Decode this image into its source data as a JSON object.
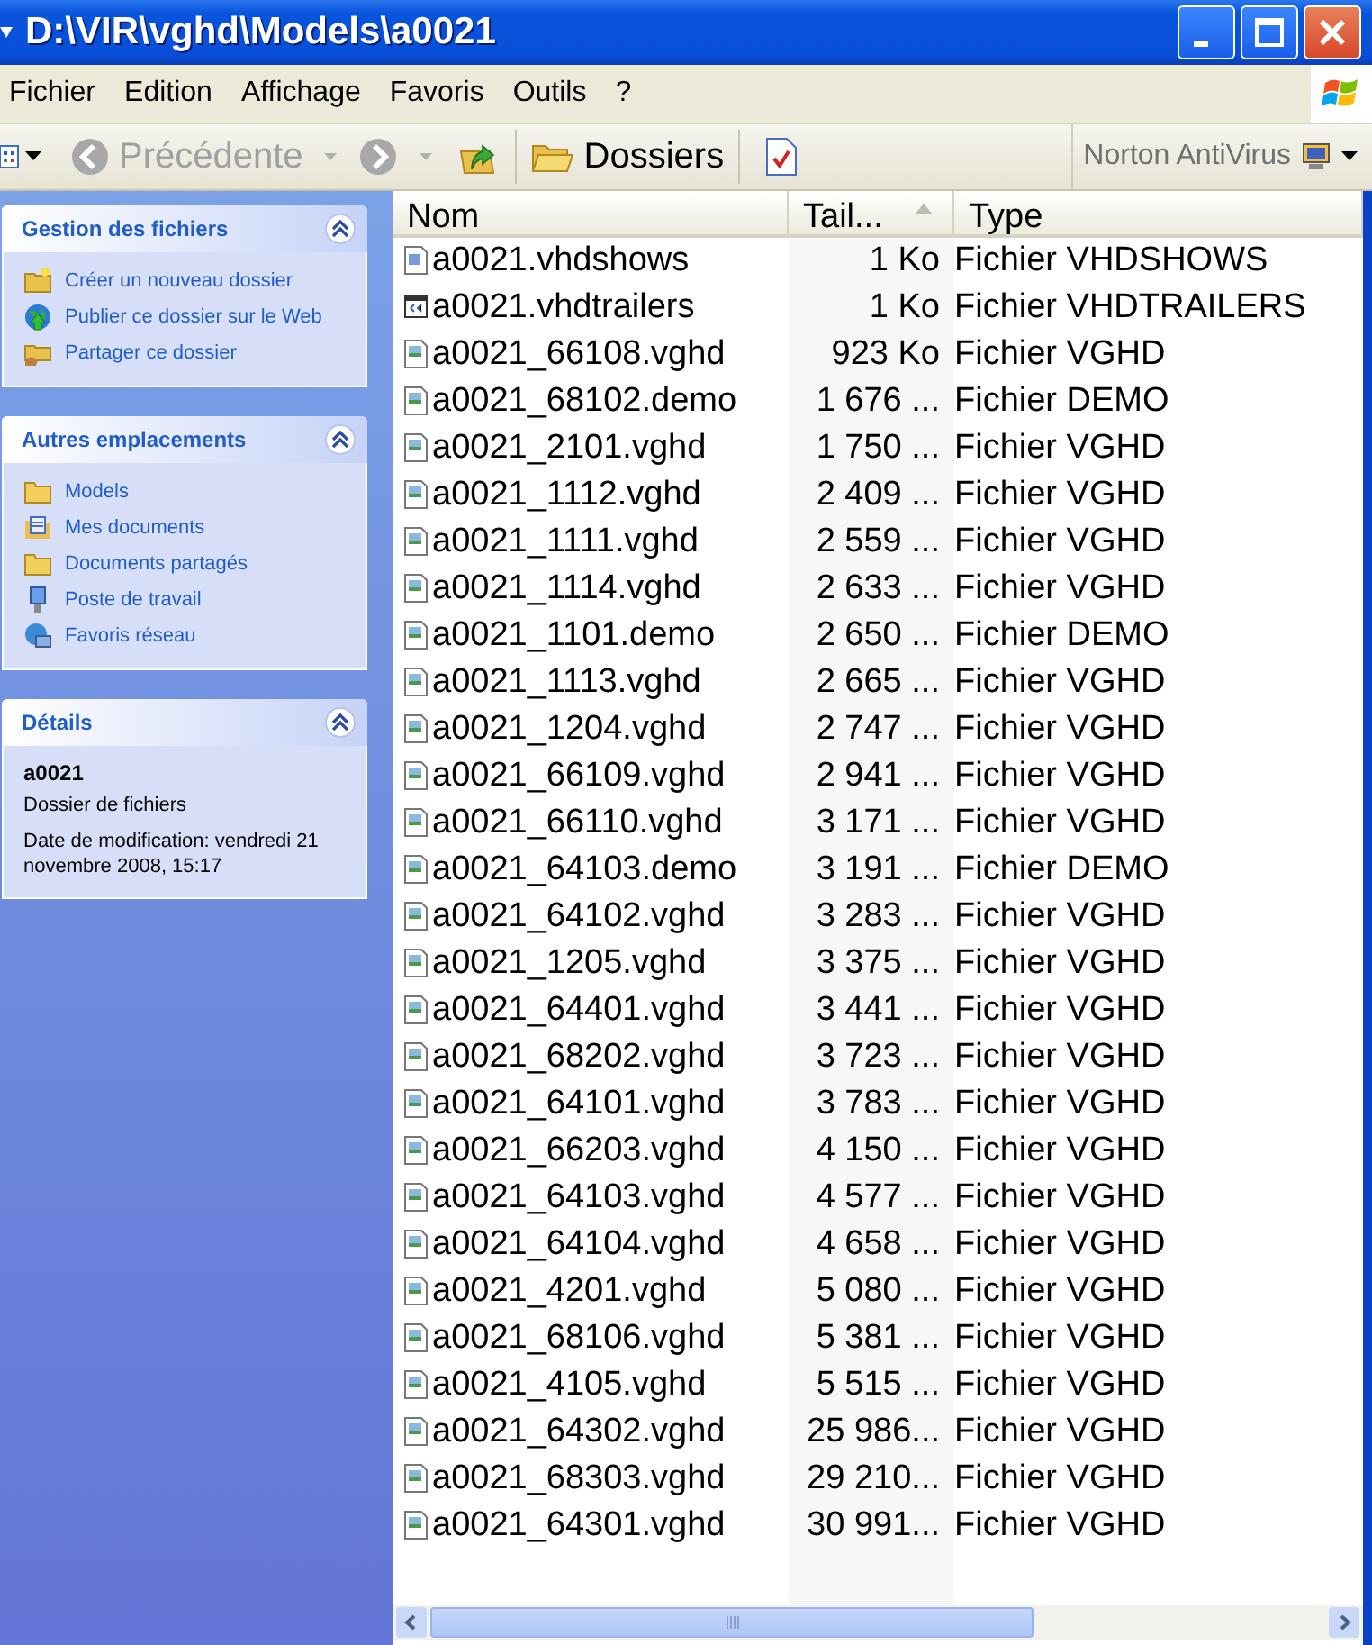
{
  "window": {
    "title": "D:\\VIR\\vghd\\Models\\a0021"
  },
  "menu": [
    "Fichier",
    "Edition",
    "Affichage",
    "Favoris",
    "Outils",
    "?"
  ],
  "toolbar": {
    "back": {
      "label": "Précédente",
      "disabled": true
    },
    "forward": {
      "disabled": true
    },
    "folders": "Dossiers",
    "antivirus": "Norton AntiVirus"
  },
  "sidebar": [
    {
      "title": "Gestion des fichiers",
      "expanded": true,
      "kind": "links",
      "items": [
        {
          "label": "Créer un nouveau dossier",
          "kind": "newfolder"
        },
        {
          "label": "Publier ce dossier sur le Web",
          "kind": "globe"
        },
        {
          "label": "Partager ce dossier",
          "kind": "share"
        }
      ]
    },
    {
      "title": "Autres emplacements",
      "expanded": true,
      "kind": "links",
      "items": [
        {
          "label": "Models",
          "kind": "folder"
        },
        {
          "label": "Mes documents",
          "kind": "documents"
        },
        {
          "label": "Documents partagés",
          "kind": "folder"
        },
        {
          "label": "Poste de travail",
          "kind": "computer"
        },
        {
          "label": "Favoris réseau",
          "kind": "network"
        }
      ]
    },
    {
      "title": "Détails",
      "expanded": true,
      "kind": "details",
      "name": "a0021",
      "type": "Dossier de fichiers",
      "modified": "Date de modification: vendredi 21 novembre 2008, 15:17"
    }
  ],
  "table": {
    "columns": [
      {
        "label": "Nom",
        "sorted": false
      },
      {
        "label": "Tail...",
        "sorted": true
      },
      {
        "label": "Type",
        "sorted": false
      }
    ],
    "rows": [
      {
        "name": "a0021.vhdshows",
        "size": "1 Ko",
        "type": "Fichier VHDSHOWS",
        "kind": "script"
      },
      {
        "name": "a0021.vhdtrailers",
        "size": "1 Ko",
        "type": "Fichier VHDTRAILERS",
        "kind": "window"
      },
      {
        "name": "a0021_66108.vghd",
        "size": "923 Ko",
        "type": "Fichier VGHD",
        "kind": "image"
      },
      {
        "name": "a0021_68102.demo",
        "size": "1 676 ...",
        "type": "Fichier DEMO",
        "kind": "image"
      },
      {
        "name": "a0021_2101.vghd",
        "size": "1 750 ...",
        "type": "Fichier VGHD",
        "kind": "image"
      },
      {
        "name": "a0021_1112.vghd",
        "size": "2 409 ...",
        "type": "Fichier VGHD",
        "kind": "image"
      },
      {
        "name": "a0021_1111.vghd",
        "size": "2 559 ...",
        "type": "Fichier VGHD",
        "kind": "image"
      },
      {
        "name": "a0021_1114.vghd",
        "size": "2 633 ...",
        "type": "Fichier VGHD",
        "kind": "image"
      },
      {
        "name": "a0021_1101.demo",
        "size": "2 650 ...",
        "type": "Fichier DEMO",
        "kind": "image"
      },
      {
        "name": "a0021_1113.vghd",
        "size": "2 665 ...",
        "type": "Fichier VGHD",
        "kind": "image"
      },
      {
        "name": "a0021_1204.vghd",
        "size": "2 747 ...",
        "type": "Fichier VGHD",
        "kind": "image"
      },
      {
        "name": "a0021_66109.vghd",
        "size": "2 941 ...",
        "type": "Fichier VGHD",
        "kind": "image"
      },
      {
        "name": "a0021_66110.vghd",
        "size": "3 171 ...",
        "type": "Fichier VGHD",
        "kind": "image"
      },
      {
        "name": "a0021_64103.demo",
        "size": "3 191 ...",
        "type": "Fichier DEMO",
        "kind": "image"
      },
      {
        "name": "a0021_64102.vghd",
        "size": "3 283 ...",
        "type": "Fichier VGHD",
        "kind": "image"
      },
      {
        "name": "a0021_1205.vghd",
        "size": "3 375 ...",
        "type": "Fichier VGHD",
        "kind": "image"
      },
      {
        "name": "a0021_64401.vghd",
        "size": "3 441 ...",
        "type": "Fichier VGHD",
        "kind": "image"
      },
      {
        "name": "a0021_68202.vghd",
        "size": "3 723 ...",
        "type": "Fichier VGHD",
        "kind": "image"
      },
      {
        "name": "a0021_64101.vghd",
        "size": "3 783 ...",
        "type": "Fichier VGHD",
        "kind": "image"
      },
      {
        "name": "a0021_66203.vghd",
        "size": "4 150 ...",
        "type": "Fichier VGHD",
        "kind": "image"
      },
      {
        "name": "a0021_64103.vghd",
        "size": "4 577 ...",
        "type": "Fichier VGHD",
        "kind": "image"
      },
      {
        "name": "a0021_64104.vghd",
        "size": "4 658 ...",
        "type": "Fichier VGHD",
        "kind": "image"
      },
      {
        "name": "a0021_4201.vghd",
        "size": "5 080 ...",
        "type": "Fichier VGHD",
        "kind": "image"
      },
      {
        "name": "a0021_68106.vghd",
        "size": "5 381 ...",
        "type": "Fichier VGHD",
        "kind": "image"
      },
      {
        "name": "a0021_4105.vghd",
        "size": "5 515 ...",
        "type": "Fichier VGHD",
        "kind": "image"
      },
      {
        "name": "a0021_64302.vghd",
        "size": "25 986...",
        "type": "Fichier VGHD",
        "kind": "image"
      },
      {
        "name": "a0021_68303.vghd",
        "size": "29 210...",
        "type": "Fichier VGHD",
        "kind": "image"
      },
      {
        "name": "a0021_64301.vghd",
        "size": "30 991...",
        "type": "Fichier VGHD",
        "kind": "image"
      }
    ]
  }
}
